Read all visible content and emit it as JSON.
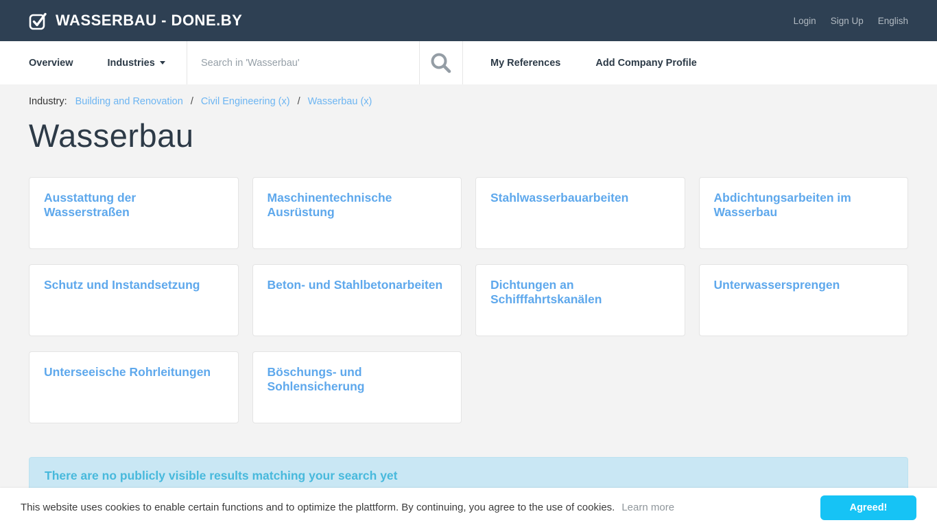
{
  "header": {
    "brand": "Wasserbau - done.by",
    "links": [
      "Login",
      "Sign Up",
      "English"
    ]
  },
  "nav": {
    "overview_label": "Overview",
    "industries_label": "Industries",
    "search_placeholder": "Search in 'Wasserbau'",
    "my_references_label": "My References",
    "add_company_label": "Add Company Profile"
  },
  "breadcrumb": {
    "label": "Industry:",
    "separator": "/",
    "links": [
      "Building and Renovation",
      "Civil Engineering (x)",
      "Wasserbau (x)"
    ]
  },
  "page": {
    "title": "Wasserbau"
  },
  "categories": [
    "Ausstattung der Wasserstraßen",
    "Maschinentechnische Ausrüstung",
    "Stahlwasserbauarbeiten",
    "Abdichtungsarbeiten im Wasserbau",
    "Schutz und Instandsetzung",
    "Beton- und Stahlbetonarbeiten",
    "Dichtungen an Schifffahrtskanälen",
    "Unterwassersprengen",
    "Unterseeische Rohrleitungen",
    "Böschungs- und Sohlensicherung"
  ],
  "alert": {
    "message": "There are no publicly visible results matching your search yet"
  },
  "cookie": {
    "message": "This website uses cookies to enable certain functions and to optimize the plattform. By continuing, you agree to the use of cookies.",
    "learn_more_label": "Learn more",
    "agree_label": "Agreed!"
  },
  "colors": {
    "header_bg": "#2e4053",
    "link_blue": "#5ea8ec",
    "breadcrumb_blue": "#6db5f2",
    "alert_bg": "#c9e7f4",
    "alert_text": "#48b9dc",
    "agree_button": "#16c3f5"
  }
}
